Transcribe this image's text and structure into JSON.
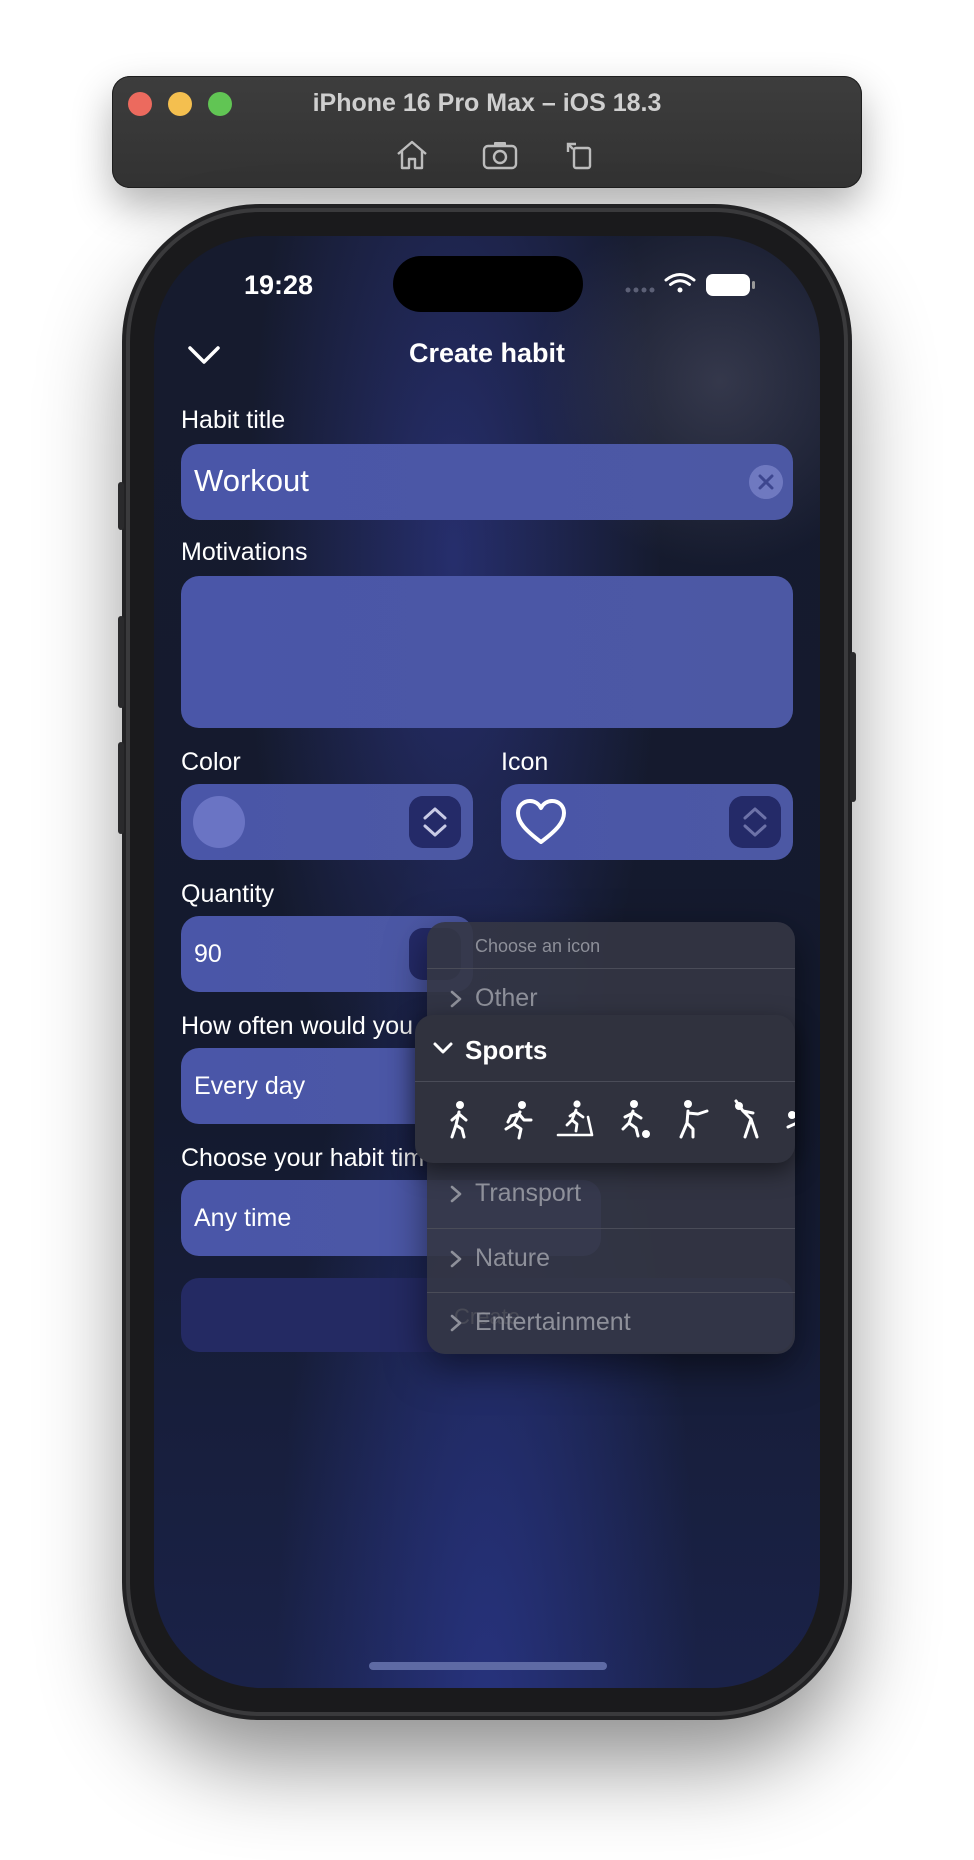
{
  "simulator": {
    "title": "iPhone 16 Pro Max – iOS 18.3",
    "toolbar": [
      "home-icon",
      "screenshot-icon",
      "rotate-icon"
    ]
  },
  "status_bar": {
    "time": "19:28",
    "icons": [
      "cellular-icon",
      "wifi-icon",
      "battery-icon"
    ]
  },
  "nav": {
    "title": "Create habit"
  },
  "form": {
    "title_label": "Habit title",
    "title_value": "Workout",
    "motivations_label": "Motivations",
    "motivations_value": "",
    "color_label": "Color",
    "icon_label": "Icon",
    "selected_icon": "heart-icon",
    "quantity_label": "Quantity",
    "quantity_value": "90",
    "frequency_label": "How often would you",
    "frequency_value": "Every day",
    "time_label": "Choose your habit tim",
    "time_value": "Any time",
    "create_label": "Create"
  },
  "icon_menu": {
    "header": "Choose an icon",
    "categories": [
      {
        "label": "Other",
        "expanded": false
      },
      {
        "label": "Sports",
        "expanded": true
      },
      {
        "label": "Transport",
        "expanded": false
      },
      {
        "label": "Nature",
        "expanded": false
      },
      {
        "label": "Entertainment",
        "expanded": false
      }
    ],
    "sports_icons": [
      "walk-icon",
      "run-icon",
      "treadmill-icon",
      "soccer-icon",
      "fencing-icon",
      "stretch-icon",
      "swim-icon"
    ]
  },
  "colors": {
    "field": "#4a56a8",
    "stepper": "#242a68",
    "create_button": "#242a63",
    "swatch": "#6a74c4"
  }
}
